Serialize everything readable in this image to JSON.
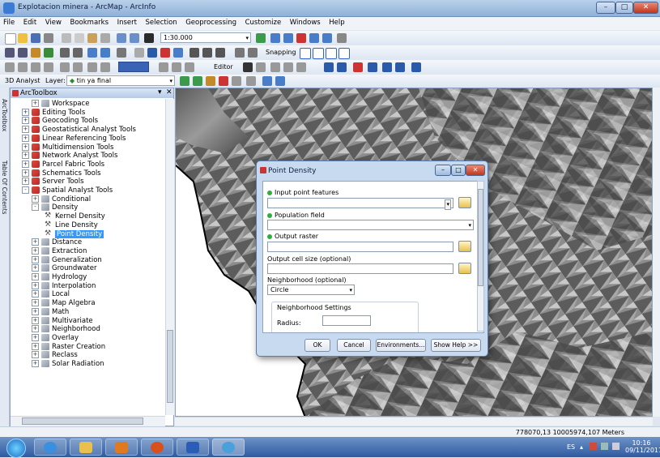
{
  "window": {
    "title": "Explotacion minera - ArcMap - ArcInfo"
  },
  "menu": [
    "File",
    "Edit",
    "View",
    "Bookmarks",
    "Insert",
    "Selection",
    "Geoprocessing",
    "Customize",
    "Windows",
    "Help"
  ],
  "toolbar": {
    "scale": "1:30.000",
    "snapping_label": "Snapping",
    "editor_label": "Editor",
    "analyst_label": "3D Analyst",
    "layer_label": "Layer:",
    "layer_value": "tin ya final"
  },
  "toolbox": {
    "title": "ArcToolbox",
    "items": [
      {
        "label": "Workspace",
        "level": 1,
        "icon": "toolset",
        "exp": "+"
      },
      {
        "label": "Editing Tools",
        "level": 0,
        "icon": "toolbox",
        "exp": "+"
      },
      {
        "label": "Geocoding Tools",
        "level": 0,
        "icon": "toolbox",
        "exp": "+"
      },
      {
        "label": "Geostatistical Analyst Tools",
        "level": 0,
        "icon": "toolbox",
        "exp": "+"
      },
      {
        "label": "Linear Referencing Tools",
        "level": 0,
        "icon": "toolbox",
        "exp": "+"
      },
      {
        "label": "Multidimension Tools",
        "level": 0,
        "icon": "toolbox",
        "exp": "+"
      },
      {
        "label": "Network Analyst Tools",
        "level": 0,
        "icon": "toolbox",
        "exp": "+"
      },
      {
        "label": "Parcel Fabric Tools",
        "level": 0,
        "icon": "toolbox",
        "exp": "+"
      },
      {
        "label": "Schematics Tools",
        "level": 0,
        "icon": "toolbox",
        "exp": "+"
      },
      {
        "label": "Server Tools",
        "level": 0,
        "icon": "toolbox",
        "exp": "+"
      },
      {
        "label": "Spatial Analyst Tools",
        "level": 0,
        "icon": "toolbox",
        "exp": "-"
      },
      {
        "label": "Conditional",
        "level": 1,
        "icon": "toolset",
        "exp": "+"
      },
      {
        "label": "Density",
        "level": 1,
        "icon": "toolset",
        "exp": "-"
      },
      {
        "label": "Kernel Density",
        "level": 2,
        "icon": "tool",
        "exp": ""
      },
      {
        "label": "Line Density",
        "level": 2,
        "icon": "tool",
        "exp": ""
      },
      {
        "label": "Point Density",
        "level": 2,
        "icon": "tool",
        "exp": "",
        "selected": true
      },
      {
        "label": "Distance",
        "level": 1,
        "icon": "toolset",
        "exp": "+"
      },
      {
        "label": "Extraction",
        "level": 1,
        "icon": "toolset",
        "exp": "+"
      },
      {
        "label": "Generalization",
        "level": 1,
        "icon": "toolset",
        "exp": "+"
      },
      {
        "label": "Groundwater",
        "level": 1,
        "icon": "toolset",
        "exp": "+"
      },
      {
        "label": "Hydrology",
        "level": 1,
        "icon": "toolset",
        "exp": "+"
      },
      {
        "label": "Interpolation",
        "level": 1,
        "icon": "toolset",
        "exp": "+"
      },
      {
        "label": "Local",
        "level": 1,
        "icon": "toolset",
        "exp": "+"
      },
      {
        "label": "Map Algebra",
        "level": 1,
        "icon": "toolset",
        "exp": "+"
      },
      {
        "label": "Math",
        "level": 1,
        "icon": "toolset",
        "exp": "+"
      },
      {
        "label": "Multivariate",
        "level": 1,
        "icon": "toolset",
        "exp": "+"
      },
      {
        "label": "Neighborhood",
        "level": 1,
        "icon": "toolset",
        "exp": "+"
      },
      {
        "label": "Overlay",
        "level": 1,
        "icon": "toolset",
        "exp": "+"
      },
      {
        "label": "Raster Creation",
        "level": 1,
        "icon": "toolset",
        "exp": "+"
      },
      {
        "label": "Reclass",
        "level": 1,
        "icon": "toolset",
        "exp": "+"
      },
      {
        "label": "Solar Radiation",
        "level": 1,
        "icon": "toolset",
        "exp": "+"
      }
    ]
  },
  "dock_tabs": {
    "toolbox": "ArcToolbox",
    "toc": "Table Of Contents"
  },
  "dialog": {
    "title": "Point Density",
    "input_label": "Input point features",
    "population_label": "Population field",
    "output_label": "Output raster",
    "cellsize_label": "Output cell size (optional)",
    "neighborhood_label": "Neighborhood (optional)",
    "neighborhood_value": "Circle",
    "settings_label": "Neighborhood Settings",
    "radius_label": "Radius:",
    "ok": "OK",
    "cancel": "Cancel",
    "environments": "Environments...",
    "show_help": "Show Help >>"
  },
  "status": {
    "coords": "778070,13  10005974,107 Meters"
  },
  "taskbar": {
    "lang": "ES",
    "time": "10:16",
    "date": "09/11/2011"
  }
}
